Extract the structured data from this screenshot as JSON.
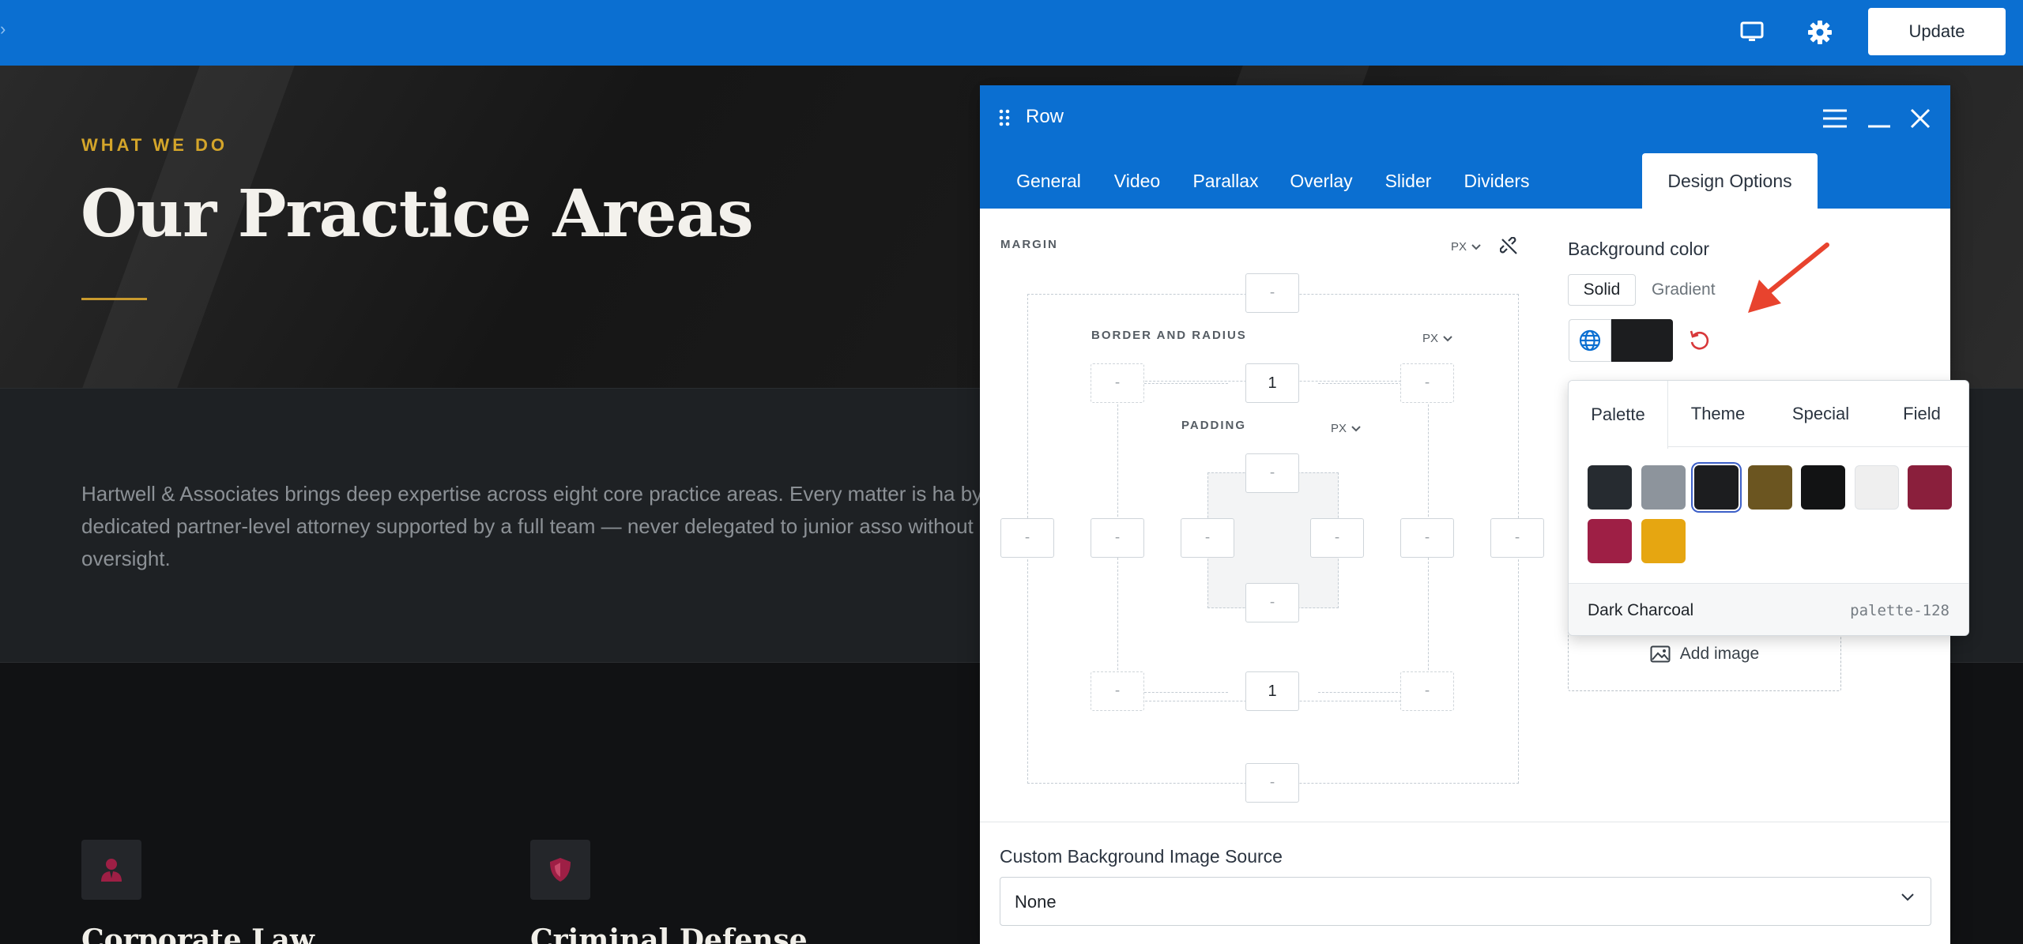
{
  "topbar": {
    "update_label": "Update",
    "icons": [
      "desktop-icon",
      "gear-icon"
    ]
  },
  "hero": {
    "eyebrow": "WHAT WE DO",
    "title": "Our Practice Areas"
  },
  "intro": {
    "text": "Hartwell & Associates brings deep expertise across eight core practice areas. Every matter is ha by a dedicated partner-level attorney supported by a full team — never delegated to junior asso without direct oversight."
  },
  "services": [
    {
      "title": "Corporate Law",
      "icon": "attorney-icon"
    },
    {
      "title": "Criminal Defense",
      "icon": "shield-icon"
    }
  ],
  "panel": {
    "title": "Row",
    "tabs": [
      "General",
      "Video",
      "Parallax",
      "Overlay",
      "Slider",
      "Dividers",
      "Design Options"
    ],
    "active_tab": "Design Options",
    "margin_label": "MARGIN",
    "border_label": "BORDER AND RADIUS",
    "padding_label": "PADDING",
    "unit": "PX",
    "placeholder": "-",
    "border_top": "1",
    "border_bottom": "1",
    "background_color_label": "Background color",
    "solid_label": "Solid",
    "gradient_label": "Gradient",
    "current_color": "#1c1d1f",
    "add_image_label": "Add image",
    "custom_bg_label": "Custom Background Image Source",
    "custom_bg_value": "None"
  },
  "palette": {
    "tabs": [
      "Palette",
      "Theme",
      "Special",
      "Field"
    ],
    "active_tab": "Palette",
    "swatches": [
      "#262b30",
      "#8d949c",
      "#1c1d1f",
      "#6b5520",
      "#121314",
      "#efefef",
      "#8a1f3c",
      "#9e1f45",
      "#e6a611"
    ],
    "selected_index": 2,
    "selected_name": "Dark Charcoal",
    "selected_slug": "palette-128"
  },
  "colors": {
    "brand_blue": "#0b6fd1",
    "accent_gold": "#d4a52a",
    "annotation_red": "#e8432e"
  }
}
